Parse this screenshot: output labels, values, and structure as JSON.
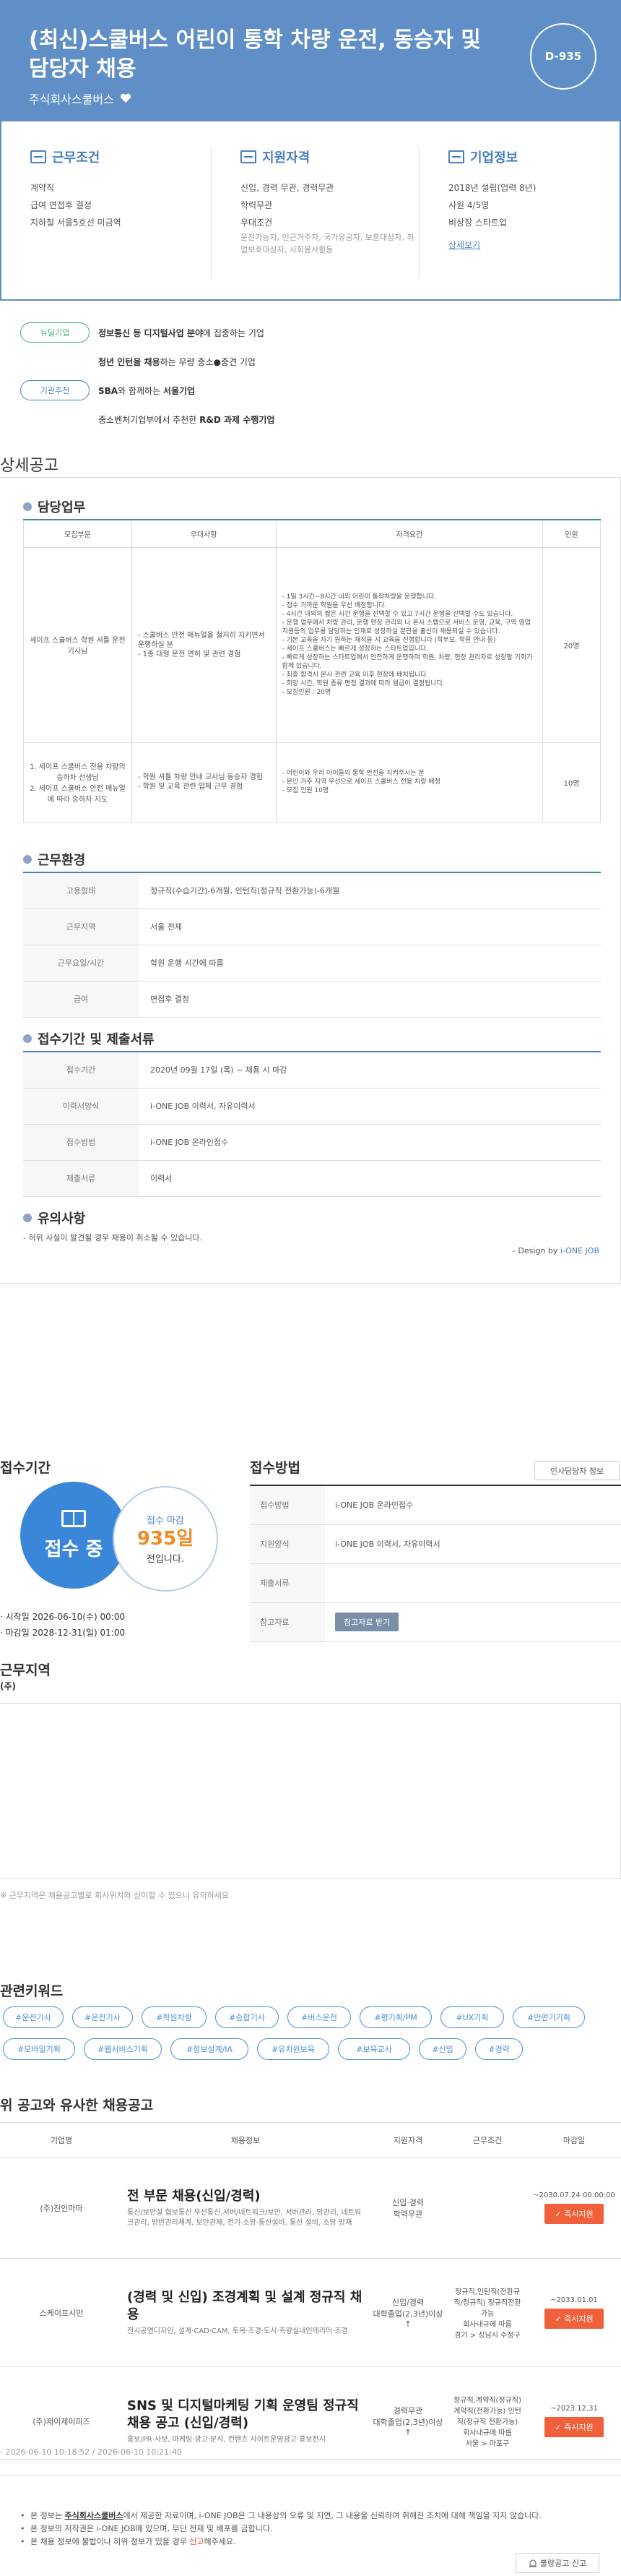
{
  "header": {
    "title": "(최신)스쿨버스 어린이 통학 차량 운전, 동승자 및 담당자 채용",
    "company": "주식회사스쿨버스",
    "dday": "D-935"
  },
  "summary": {
    "conditions": {
      "title": "근무조건",
      "lines": [
        "계약직",
        "급여 면접후 결정",
        "지하철 서울5호선 미금역"
      ]
    },
    "qualification": {
      "title": "지원자격",
      "lines": [
        "신입, 경력 무관, 경력무관",
        "학력무관",
        "우대조건"
      ],
      "prefs": "운전가능자, 인근거주자, 국가유공자, 보훈대상자, 취업보호대상자, 사회봉사활동"
    },
    "company": {
      "title": "기업정보",
      "lines": [
        "2018년 설립(업력 8년)",
        "사원 4/5명",
        "비상장 스타트업"
      ],
      "link": "상세보기"
    }
  },
  "tags": [
    {
      "pill": "뉴딜기업",
      "strong": "정보통신 등 디지털사업 분야",
      "text": "에 집중하는 기업"
    },
    {
      "pill": "",
      "strong": "청년 인턴을 채용",
      "text": "하는 우량 중소●중견 기업"
    },
    {
      "pill": "기관추천",
      "strong": "SBA",
      "text": "와 함께하는 ",
      "strong2": "서울기업"
    },
    {
      "pill": "",
      "strong": "",
      "text": "중소벤처기업부에서 추천한 ",
      "strong2": "R&D 과제 수행기업"
    }
  ],
  "detail": {
    "section_title": "상세공고",
    "duty": {
      "title": "담당업무",
      "headers": [
        "모집부문",
        "우대사항",
        "자격요건",
        "인원"
      ],
      "rows": [
        {
          "dept": "세이프 스쿨버스 학원 셔틀 운전 기사님",
          "pref": "- 스쿨버스 안전 매뉴얼을 철저히 지키면서 운행하실 분\n- 1종 대형 운전 면허 및 관련 경험",
          "req": "- 1일 3시간~8시간 내외 어린이 통학차량을 운행합니다.\n- 접수 가까운 학원을 우선 배정합니다.\n- 4시간 내외의 짧은 시간 운행을 선택할 수 있고 7시간 운행을 선택할 수도 있습니다.\n- 운행 업무에서 차량 관리, 운행 현장 관리외 나 본사 스텝으로 서비스 운영, 교육, 구역 영업 지원등의 업무를 담당하는 인재로 성장하실 분만을 출신이 채용되실 수 있습니다.\n- 기본 교육을 자기 원하는 재직을 시 교육을 진행합니다 (학부모, 학원 안내 등)\n- 세이프 스쿨버스는 빠르게 성장하는 스타트업입니다.\n- 빠르게 성장하는 스타트업에서 안전하게 운행하며 학원, 차량, 현장 관리자로 성장할 기회가 함께 있습니다.\n- 최종 합격시 본사 관련 교육 이후 현장에 배치됩니다.\n- 희망 시간, 학원 종류 면접 결과에 따라 월급이 결정됩니다.\n- 모집인원 : 20명",
          "count": "20명"
        },
        {
          "dept": "1. 세이프 스쿨버스 전용 차량의 승하차 선생님\n2. 세이프 스쿨버스 안전 매뉴얼에 따라 승하차 지도",
          "pref": "- 학원 셔틀 차량 안내 교사님 동승자 경험\n- 학원 및 교육 관련 업체 근무 경험",
          "req": "- 어린이와 우리 아이들의 통학 안전을 지켜주시는 분\n- 본인 거주 지역 우선으로 세이프 스쿨버스 전용 차량 배정\n- 모집 인원 10명",
          "count": "10명"
        }
      ]
    },
    "environment": {
      "title": "근무환경",
      "rows": [
        {
          "k": "고용형태",
          "v": "정규직(수습기간)-6개월, 인턴직(정규직 전환가능)-6개월"
        },
        {
          "k": "근무지역",
          "v": "서울 전체"
        },
        {
          "k": "근무요일/시간",
          "v": "학원 운행 시간에 따름"
        },
        {
          "k": "급여",
          "v": "면접후 결정"
        }
      ]
    },
    "application": {
      "title": "접수기간 및 제출서류",
      "rows": [
        {
          "k": "접수기간",
          "v": "2020년 09월 17일 (목) ~ 채용 시 마감"
        },
        {
          "k": "이력서양식",
          "v": "i-ONE JOB 이력서, 자유이력서"
        },
        {
          "k": "접수방법",
          "v": "i-ONE JOB 온라인접수"
        },
        {
          "k": "제출서류",
          "v": "이력서"
        }
      ]
    },
    "caution": {
      "title": "유의사항",
      "text": "- 허위 사실이 발견될 경우 채용이 취소될 수 있습니다.",
      "design_prefix": "- Design by ",
      "design_brand": "i-ONE JOB"
    }
  },
  "period": {
    "title": "접수기간",
    "status": "접수 중",
    "deadline_label": "접수 마감",
    "deadline_days": "935일",
    "deadline_suffix": "전입니다.",
    "start": "· 시작일 2026-06-10(수) 00:00",
    "end": "· 마감일 2028-12-31(일) 01:00"
  },
  "method": {
    "title": "접수방법",
    "contact_button": "인사담당자 정보",
    "rows": [
      {
        "k": "접수방법",
        "v": "i-ONE JOB 온라인접수"
      },
      {
        "k": "지원양식",
        "v": "i-ONE JOB 이력서, 자유이력서"
      },
      {
        "k": "제출서류",
        "v": ""
      },
      {
        "k": "참고자료",
        "v": "참고자료 받기"
      }
    ]
  },
  "region": {
    "title": "근무지역",
    "subtitle": "(주)"
  },
  "warning": "※ 근무지역은 채용공고별로 회사위치와 상이할 수 있으니 유의하세요.",
  "keywords": {
    "title": "관련키워드",
    "items": [
      "#운전기사",
      "#운전기사",
      "#학원차량",
      "#승합기사",
      "#버스운전",
      "#평기획/PM",
      "#UX기획",
      "#안면기기획",
      "#모바일기획",
      "#웹서비스기획",
      "#정보설계/IA",
      "#유치원보육",
      "#보육교사",
      "#신입",
      "#경력"
    ]
  },
  "similar": {
    "title": "위 공고와 유사한 채용공고",
    "headers": [
      "기업명",
      "채용정보",
      "지원자격",
      "근무조건",
      "마감일"
    ],
    "apply_label": "즉시지원",
    "rows": [
      {
        "company": "(주)진인마마",
        "title": "전 부문 채용(신입/경력)",
        "summary": "통신/보안설 협보통신 무선통신,서버/네트워크/보안, 서버관리, 망관리, 네트워크관리, 방반관리체계, 보안관제, 전기·소방·통신설비, 통신 설비, 소방 방재",
        "qual": "신입·경력\n학력무관",
        "cond": "",
        "deadline": "~2030.07.24 00:00:00"
      },
      {
        "company": "스케이프시만",
        "title": "(경력 및 신입) 조경계획 및 설계 정규직 채용",
        "summary": "전시공연디자인, 설계·CAD·CAM, 토목·조경·도시·측량실내인테리어·조경",
        "qual": "신입/경력\n대학졸업(2,3년)이상↑",
        "cond": "정규직,인턴직(전환규직/정규직) 정규직전환가능\n회사내규에 따름\n경기 > 성남시 수정구",
        "deadline": "~2033.01.01"
      },
      {
        "company": "(주)제이제이피즈",
        "title": "SNS 및 디지털마케팅 기획 운영팀 정규직 채용 공고 (신입/경력)",
        "summary": "홍보/PR·사보, 마케팅·광고·분석, 컨텐츠 사이트운영광고·홍보전시",
        "qual": "경력무관\n대학졸업(2,3년)이상↑",
        "cond": "정규직,계약직(정규직)계약직(전환가능) 인턴직(정규직 전환가능)\n회사내규에 따름\n서울 > 마포구",
        "deadline": "~2023.12.31"
      }
    ]
  },
  "footer_time": "- 2026-06-10 10:18:52 / 2026-06-10 10:21:40",
  "notices": {
    "n1_pre": "본 정보는 ",
    "n1_company": "주식회사스쿨버스",
    "n1_post": "에서 제공한 자료이며, i-ONE JOB은 그 내용상의 오류 및 지연, 그 내용을 신뢰하여 취해진 조치에 대해 책임을 지지 않습니다.",
    "n2": "본 정보의 저작권은 i-ONE JOB에 있으며, 무단 전재 및 배포를 금합니다.",
    "n3_pre": "본 채용 정보에 불법이나 허위 정보가 있을 경우 ",
    "n3_red": "신고",
    "n3_post": "해주세요.",
    "report": "불량공고 신고"
  }
}
